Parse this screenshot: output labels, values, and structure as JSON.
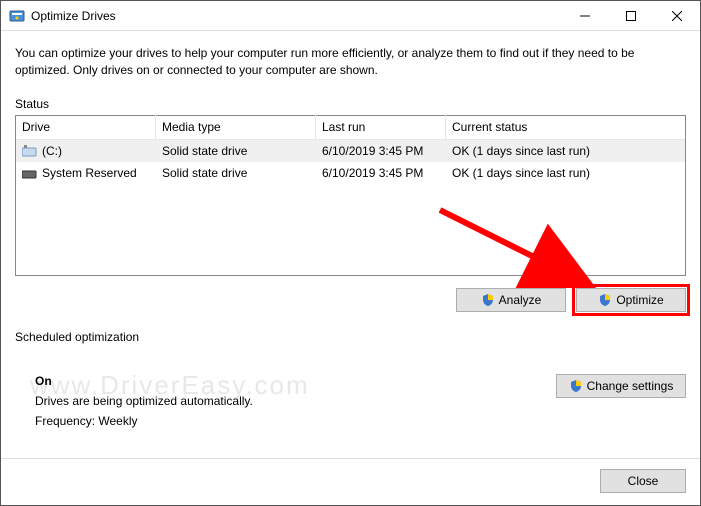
{
  "window": {
    "title": "Optimize Drives"
  },
  "description": "You can optimize your drives to help your computer run more efficiently, or analyze them to find out if they need to be optimized. Only drives on or connected to your computer are shown.",
  "status_label": "Status",
  "columns": {
    "drive": "Drive",
    "media": "Media type",
    "last": "Last run",
    "status": "Current status"
  },
  "rows": [
    {
      "drive": "(C:)",
      "media": "Solid state drive",
      "last": "6/10/2019 3:45 PM",
      "status": "OK (1 days since last run)"
    },
    {
      "drive": "System Reserved",
      "media": "Solid state drive",
      "last": "6/10/2019 3:45 PM",
      "status": "OK (1 days since last run)"
    }
  ],
  "buttons": {
    "analyze": "Analyze",
    "optimize": "Optimize",
    "change": "Change settings",
    "close": "Close"
  },
  "scheduled": {
    "label": "Scheduled optimization",
    "on": "On",
    "line1": "Drives are being optimized automatically.",
    "line2": "Frequency: Weekly"
  },
  "watermark": "www.DriverEasy.com"
}
